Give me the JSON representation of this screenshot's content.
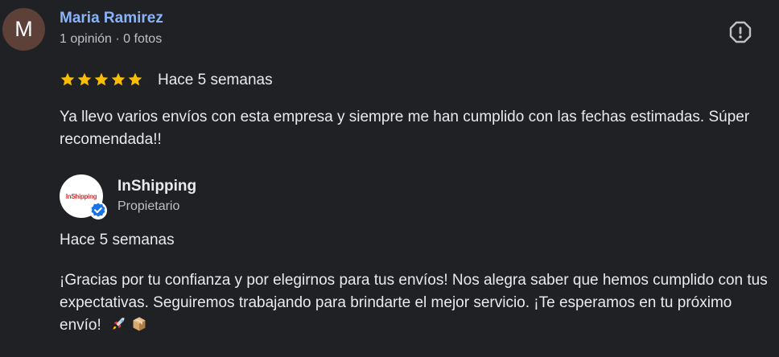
{
  "review": {
    "avatar_letter": "M",
    "avatar_color": "#5d4037",
    "author_name": "Maria Ramirez",
    "author_meta": "1 opinión · 0 fotos",
    "rating": 5,
    "max_rating": 5,
    "star_color": "#fbbc04",
    "date": "Hace 5 semanas",
    "text": "Ya llevo varios envíos con esta empresa y siempre me han cumplido con las fechas estimadas. Súper recomendada!!",
    "report_icon": "report-flag-icon"
  },
  "owner_reply": {
    "name": "InShipping",
    "logo_text_red": "InShipping",
    "logo_text_blue": "",
    "role": "Propietario",
    "verified_icon": "verified-check-icon",
    "verified_color": "#1a73e8",
    "date": "Hace 5 semanas",
    "text": "¡Gracias por tu confianza y por elegirnos para tus envíos! Nos alegra saber que hemos cumplido con tus expectativas. Seguiremos trabajando para brindarte el mejor servicio. ¡Te esperamos en tu próximo envío!",
    "emojis": [
      "rocket-icon",
      "package-icon"
    ]
  }
}
